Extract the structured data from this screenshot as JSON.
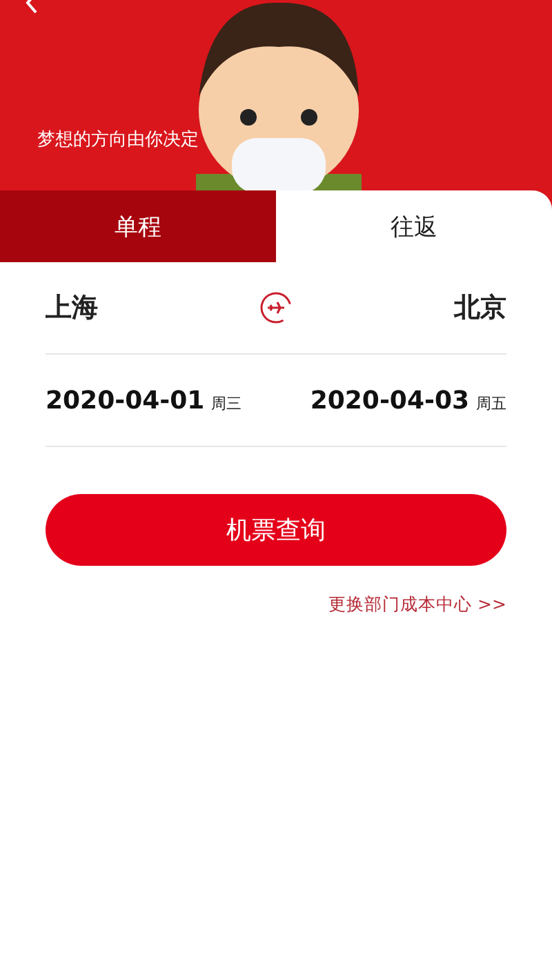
{
  "banner": {
    "caption": "梦想的方向由你决定"
  },
  "tabs": [
    {
      "label": "单程",
      "selected": false
    },
    {
      "label": "往返",
      "selected": true
    }
  ],
  "route": {
    "from": "上海",
    "to": "北京"
  },
  "dates": [
    {
      "date": "2020-04-01",
      "weekday": "周三"
    },
    {
      "date": "2020-04-03",
      "weekday": "周五"
    }
  ],
  "search_button": "机票查询",
  "cost_center_link": "更换部门成本中心 >>"
}
